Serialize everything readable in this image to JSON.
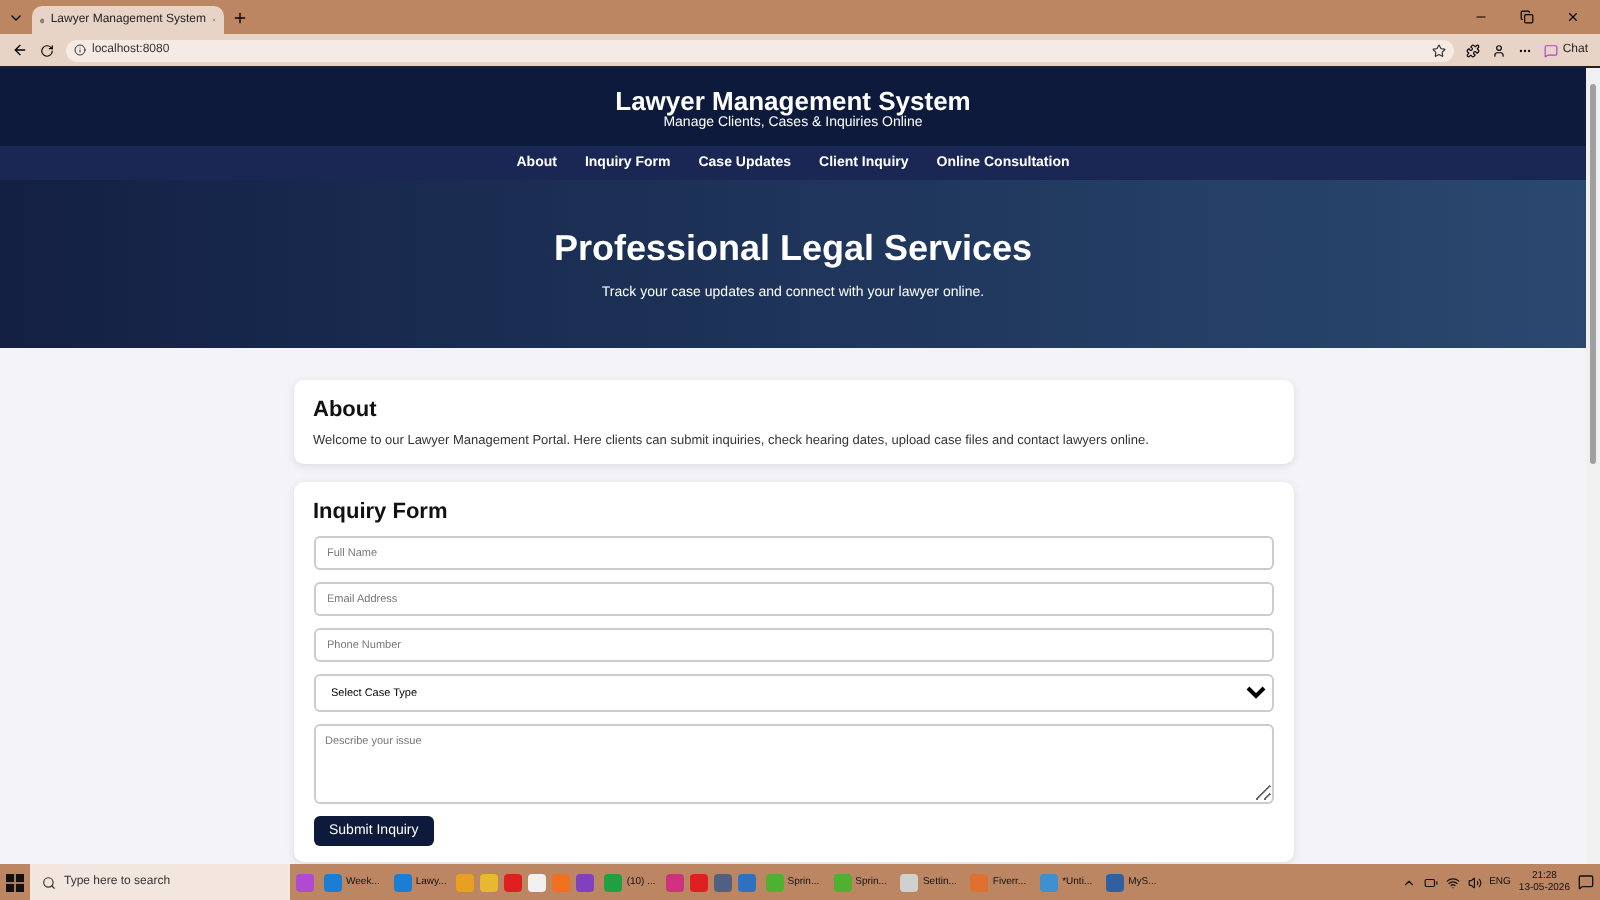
{
  "browser": {
    "tab_title": "Lawyer Management System",
    "url": "localhost:8080",
    "chat_label": "Chat"
  },
  "header": {
    "title": "Lawyer Management System",
    "subtitle": "Manage Clients, Cases & Inquiries Online"
  },
  "nav": [
    "About",
    "Inquiry Form",
    "Case Updates",
    "Client Inquiry",
    "Online Consultation"
  ],
  "hero": {
    "title": "Professional Legal Services",
    "subtitle": "Track your case updates and connect with your lawyer online."
  },
  "about": {
    "title": "About",
    "text": "Welcome to our Lawyer Management Portal. Here clients can submit inquiries, check hearing dates, upload case files and contact lawyers online."
  },
  "inquiry_form": {
    "title": "Inquiry Form",
    "fields": [
      {
        "kind": "input",
        "placeholder": "Full Name"
      },
      {
        "kind": "input",
        "placeholder": "Email Address"
      },
      {
        "kind": "input",
        "placeholder": "Phone Number"
      },
      {
        "kind": "select",
        "value": "Select Case Type"
      },
      {
        "kind": "textarea",
        "placeholder": "Describe your issue"
      }
    ],
    "submit": "Submit Inquiry"
  },
  "taskbar": {
    "search_placeholder": "Type here to search",
    "apps": [
      {
        "color": "#b04ad0"
      },
      {
        "label": "Week...",
        "color": "#1a7fd4"
      },
      {
        "label": "Lawy...",
        "color": "#1a7fd4"
      },
      {
        "color": "#e8a020"
      },
      {
        "color": "#e8b830"
      },
      {
        "color": "#e02020"
      },
      {
        "color": "#f0f0f0"
      },
      {
        "color": "#f07020"
      },
      {
        "color": "#8040c0"
      },
      {
        "label": "(10) ...",
        "color": "#20a040"
      },
      {
        "color": "#d03080"
      },
      {
        "color": "#e02020"
      },
      {
        "color": "#506080"
      },
      {
        "color": "#3070c0"
      },
      {
        "label": "Sprin...",
        "color": "#50b030"
      },
      {
        "label": "Sprin...",
        "color": "#50b030"
      },
      {
        "label": "Settin...",
        "color": "#d0d0d0"
      },
      {
        "label": "Fiverr...",
        "color": "#e07030"
      },
      {
        "label": "*Unti...",
        "color": "#4090d0"
      },
      {
        "label": "MyS...",
        "color": "#3060a0"
      }
    ],
    "language": "ENG",
    "time": "21:28",
    "date": "13-05-2026"
  }
}
